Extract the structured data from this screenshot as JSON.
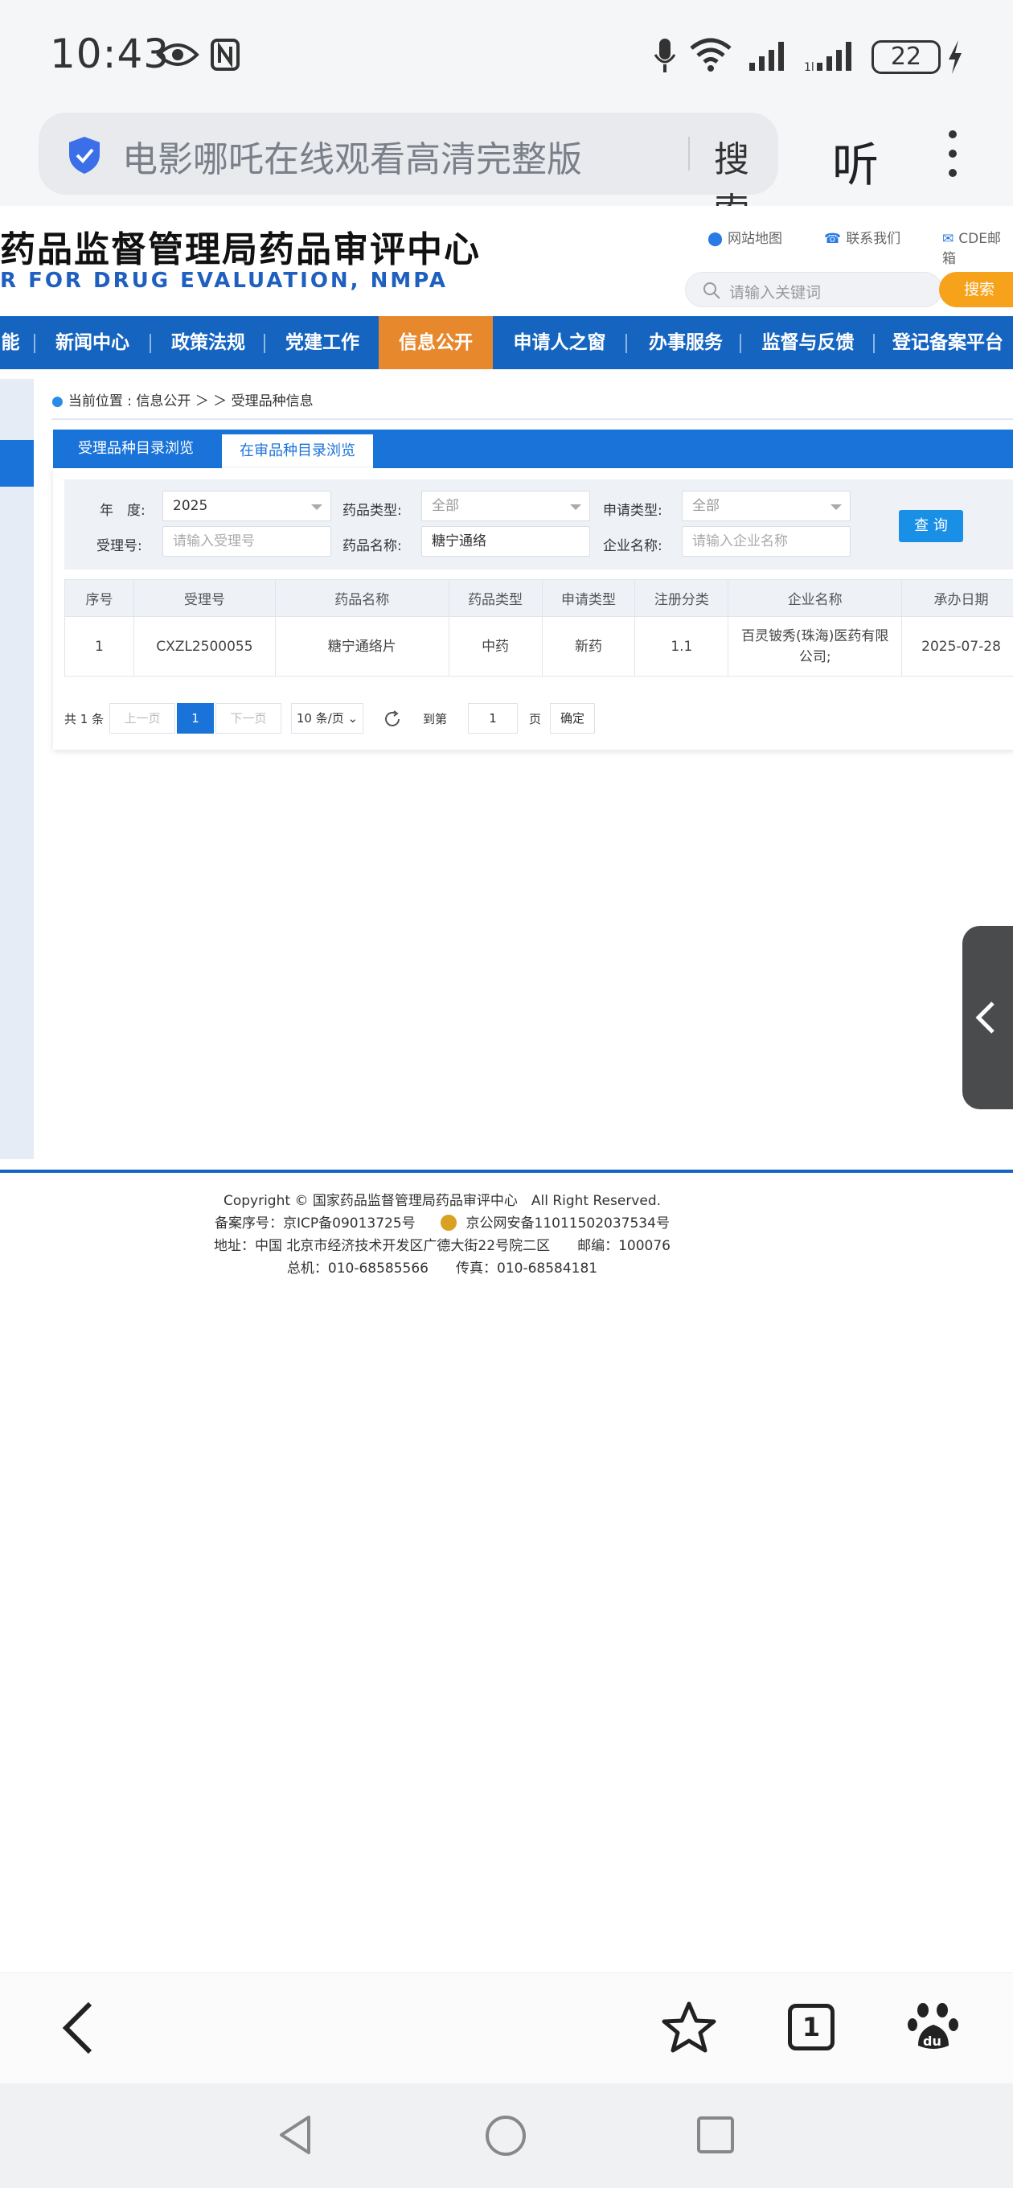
{
  "status_bar": {
    "time": "10:43",
    "battery": "22"
  },
  "browser": {
    "search_query": "电影哪吒在线观看高清完整版",
    "search_button": "搜索",
    "listen_button": "听"
  },
  "site": {
    "title_cn": "药品监督管理局药品审评中心",
    "title_en": "R FOR DRUG EVALUATION, NMPA",
    "top_links": {
      "sitemap": "网站地图",
      "contact": "联系我们",
      "mail": "CDE邮箱"
    },
    "search": {
      "placeholder": "请输入关键词",
      "button": "搜索"
    },
    "nav": [
      "能",
      "新闻中心",
      "政策法规",
      "党建工作",
      "信息公开",
      "申请人之窗",
      "办事服务",
      "监督与反馈",
      "登记备案平台"
    ],
    "breadcrumb": "当前位置 : 信息公开 ＞ ＞ 受理品种信息",
    "tabs": [
      "受理品种目录浏览",
      "在审品种目录浏览"
    ],
    "filters": {
      "year_label": "年　度:",
      "year_value": "2025",
      "drug_type_label": "药品类型:",
      "drug_type_value": "全部",
      "apply_type_label": "申请类型:",
      "apply_type_value": "全部",
      "accept_no_label": "受理号:",
      "accept_no_placeholder": "请输入受理号",
      "drug_name_label": "药品名称:",
      "drug_name_value": "糖宁通络",
      "company_label": "企业名称:",
      "company_placeholder": "请输入企业名称",
      "query_button": "查 询"
    },
    "table": {
      "headers": [
        "序号",
        "受理号",
        "药品名称",
        "药品类型",
        "申请类型",
        "注册分类",
        "企业名称",
        "承办日期"
      ],
      "rows": [
        [
          "1",
          "CXZL2500055",
          "糖宁通络片",
          "中药",
          "新药",
          "1.1",
          "百灵铍秀(珠海)医药有限公司;",
          "2025-07-28"
        ]
      ]
    },
    "pager": {
      "total": "共 1 条",
      "prev": "上一页",
      "current": "1",
      "next": "下一页",
      "page_size": "10 条/页",
      "goto_label": "到第",
      "goto_value": "1",
      "page_unit": "页",
      "confirm": "确定"
    },
    "footer": {
      "copyright": "Copyright © 国家药品监督管理局药品审评中心　All Right Reserved.",
      "icp": "备案序号：京ICP备09013725号",
      "police": "京公网安备11011502037534号",
      "address": "地址：中国 北京市经济技术开发区广德大街22号院二区　　邮编：100076",
      "phone": "总机：010-68585566　　传真：010-68584181"
    }
  },
  "bottom_toolbar": {
    "tab_count": "1"
  },
  "colors": {
    "nav_blue": "#1565c0",
    "nav_active": "#e8882c",
    "accent_orange": "#f7a21b",
    "tab_blue": "#1a73d9"
  }
}
